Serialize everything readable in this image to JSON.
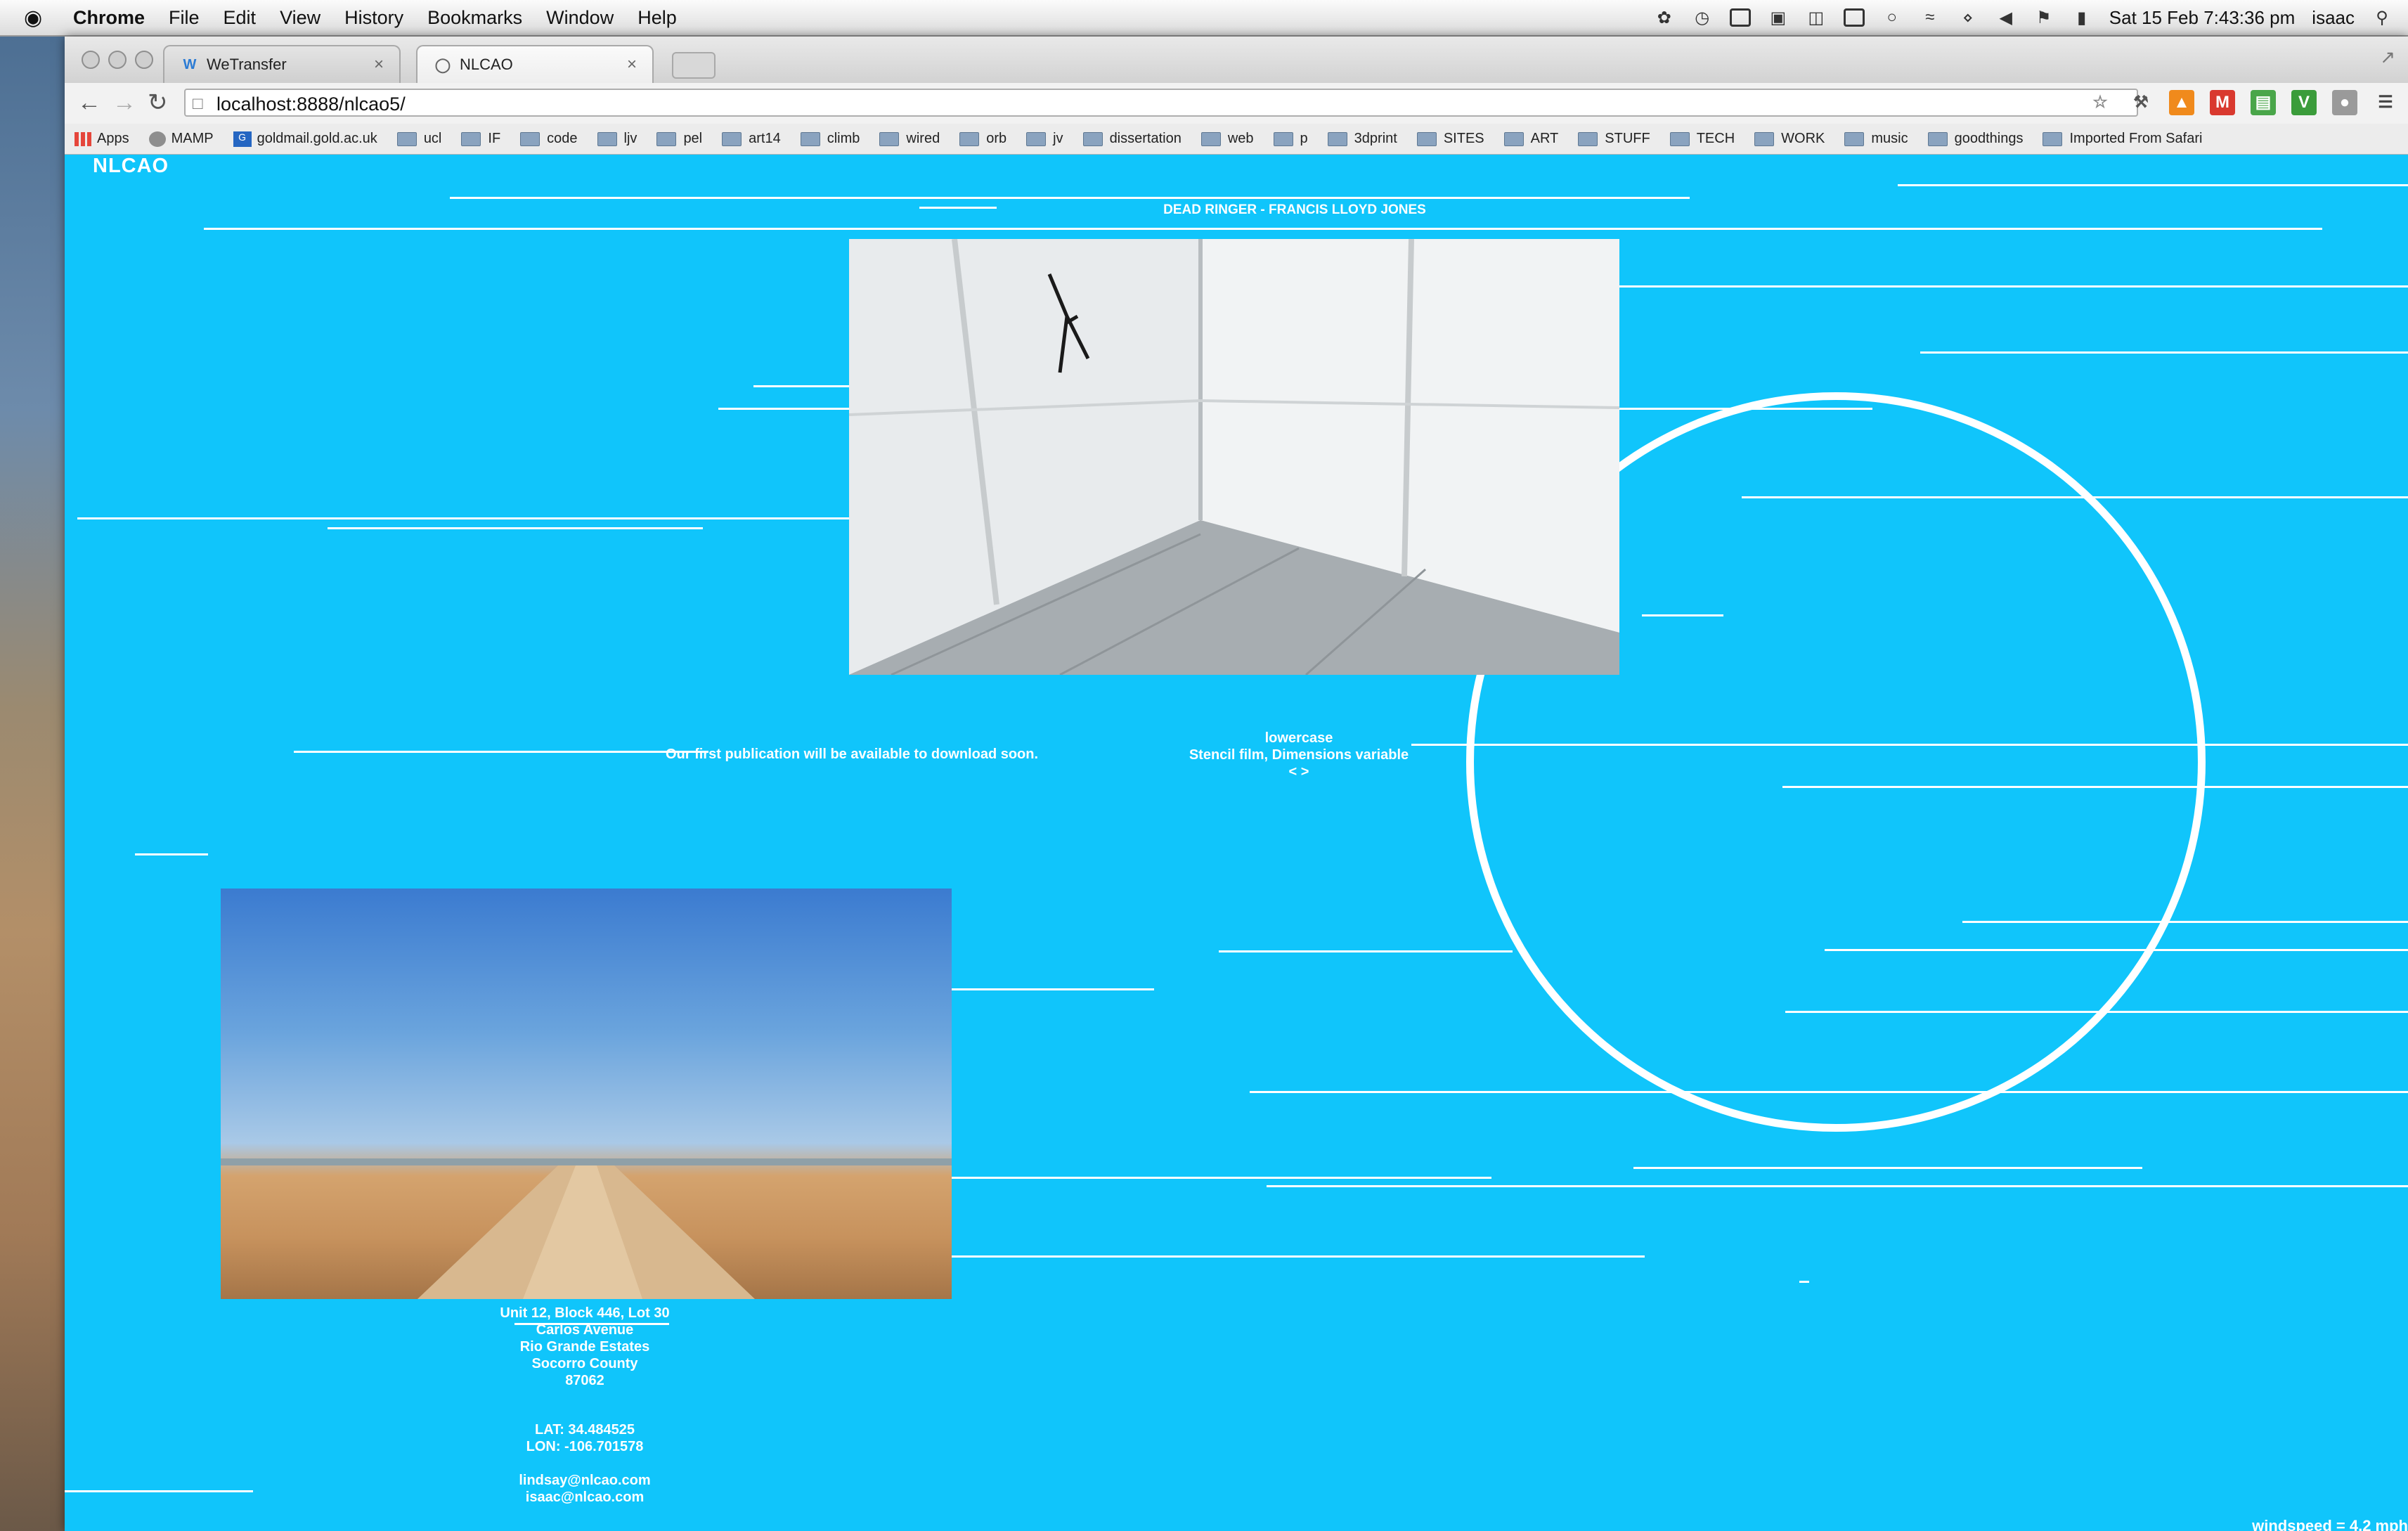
{
  "menubar": {
    "app": "Chrome",
    "items": [
      "File",
      "Edit",
      "View",
      "History",
      "Bookmarks",
      "Window",
      "Help"
    ],
    "clock": "Sat 15 Feb  7:43:36 pm",
    "user": "isaac"
  },
  "tabs": [
    {
      "label": "WeTransfer",
      "favicon": "wetransfer-icon"
    },
    {
      "label": "NLCAO",
      "favicon": "globe-icon"
    }
  ],
  "toolbar": {
    "url": "localhost:8888/nlcao5/"
  },
  "bookmarks": [
    {
      "label": "Apps",
      "icon": "apps-icon"
    },
    {
      "label": "MAMP",
      "icon": "globe-icon"
    },
    {
      "label": "goldmail.gold.ac.uk",
      "icon": "gold-icon"
    },
    {
      "label": "ucl",
      "icon": "folder-icon"
    },
    {
      "label": "IF",
      "icon": "folder-icon"
    },
    {
      "label": "code",
      "icon": "folder-icon"
    },
    {
      "label": "ljv",
      "icon": "folder-icon"
    },
    {
      "label": "pel",
      "icon": "folder-icon"
    },
    {
      "label": "art14",
      "icon": "folder-icon"
    },
    {
      "label": "climb",
      "icon": "folder-icon"
    },
    {
      "label": "wired",
      "icon": "folder-icon"
    },
    {
      "label": "orb",
      "icon": "folder-icon"
    },
    {
      "label": "jv",
      "icon": "folder-icon"
    },
    {
      "label": "dissertation",
      "icon": "folder-icon"
    },
    {
      "label": "web",
      "icon": "folder-icon"
    },
    {
      "label": "p",
      "icon": "folder-icon"
    },
    {
      "label": "3dprint",
      "icon": "folder-icon"
    },
    {
      "label": "SITES",
      "icon": "folder-icon"
    },
    {
      "label": "ART",
      "icon": "folder-icon"
    },
    {
      "label": "STUFF",
      "icon": "folder-icon"
    },
    {
      "label": "TECH",
      "icon": "folder-icon"
    },
    {
      "label": "WORK",
      "icon": "folder-icon"
    },
    {
      "label": "music",
      "icon": "folder-icon"
    },
    {
      "label": "goodthings",
      "icon": "folder-icon"
    },
    {
      "label": "Imported From Safari",
      "icon": "folder-icon"
    }
  ],
  "page": {
    "logo": "NLCAO",
    "exhibit_title": "DEAD RINGER - FRANCIS LLOYD JONES",
    "caption_title": "lowercase",
    "caption_medium": "Stencil film, Dimensions variable",
    "caption_nav": "< >",
    "publication_note": "Our first publication will be available to download soon.",
    "address": [
      "Unit 12, Block 446, Lot 30",
      "Carlos Avenue",
      "Rio Grande Estates",
      "Socorro County",
      "87062"
    ],
    "coords": [
      "LAT: 34.484525",
      "LON: -106.701578"
    ],
    "emails": [
      "lindsay@nlcao.com",
      "isaac@nlcao.com"
    ],
    "footer": "windspeed = 4.2 mph"
  },
  "colors": {
    "page_background": "#10c5fb",
    "line_color": "#ffffff"
  }
}
